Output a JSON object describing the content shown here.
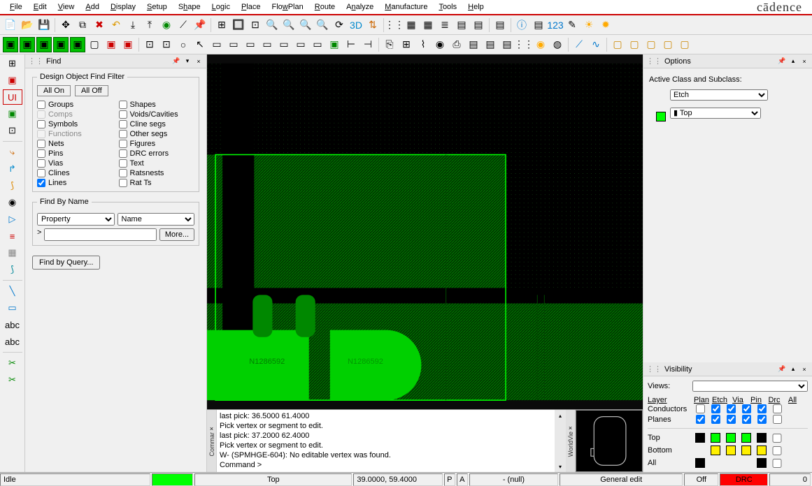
{
  "menus": [
    "File",
    "Edit",
    "View",
    "Add",
    "Display",
    "Setup",
    "Shape",
    "Logic",
    "Place",
    "FlowPlan",
    "Route",
    "Analyze",
    "Manufacture",
    "Tools",
    "Help"
  ],
  "brand": "cādence",
  "find": {
    "title": "Find",
    "legend": "Design Object Find Filter",
    "all_on": "All On",
    "all_off": "All Off",
    "items_left": [
      {
        "label": "Groups",
        "checked": false,
        "enabled": true
      },
      {
        "label": "Comps",
        "checked": false,
        "enabled": false
      },
      {
        "label": "Symbols",
        "checked": false,
        "enabled": true
      },
      {
        "label": "Functions",
        "checked": false,
        "enabled": false
      },
      {
        "label": "Nets",
        "checked": false,
        "enabled": true
      },
      {
        "label": "Pins",
        "checked": false,
        "enabled": true
      },
      {
        "label": "Vias",
        "checked": false,
        "enabled": true
      },
      {
        "label": "Clines",
        "checked": false,
        "enabled": true
      },
      {
        "label": "Lines",
        "checked": true,
        "enabled": true
      }
    ],
    "items_right": [
      {
        "label": "Shapes",
        "checked": false,
        "enabled": true
      },
      {
        "label": "Voids/Cavities",
        "checked": false,
        "enabled": true
      },
      {
        "label": "Cline segs",
        "checked": false,
        "enabled": true
      },
      {
        "label": "Other segs",
        "checked": false,
        "enabled": true
      },
      {
        "label": "Figures",
        "checked": false,
        "enabled": true
      },
      {
        "label": "DRC errors",
        "checked": false,
        "enabled": true
      },
      {
        "label": "Text",
        "checked": false,
        "enabled": true
      },
      {
        "label": "Ratsnests",
        "checked": false,
        "enabled": true
      },
      {
        "label": "Rat Ts",
        "checked": false,
        "enabled": true
      }
    ],
    "find_by_name_legend": "Find By Name",
    "property_selected": "Property",
    "name_selected": "Name",
    "more": "More...",
    "find_by_query": "Find by Query..."
  },
  "canvas": {
    "net_label_a": "N1286592",
    "net_label_b": "N1286592"
  },
  "command": {
    "lines": [
      "last pick:   36.5000 61.4000",
      "Pick vertex or segment to edit.",
      "last pick:   37.2000 62.4000",
      "Pick vertex or segment to edit.",
      "W- (SPMHGE-604): No editable vertex was found.",
      "Command >"
    ],
    "strip_label": "Commar",
    "worldview_label": "WorldVie"
  },
  "options": {
    "title": "Options",
    "label": "Active Class and Subclass:",
    "class_value": "Etch",
    "subclass_value": "Top"
  },
  "visibility": {
    "title": "Visibility",
    "views_label": "Views:",
    "layer_label": "Layer",
    "cols": [
      "Plan",
      "Etch",
      "Via",
      "Pin",
      "Drc",
      "All"
    ],
    "rows": [
      {
        "label": "Conductors",
        "checks": [
          false,
          true,
          true,
          true,
          true,
          false
        ]
      },
      {
        "label": "Planes",
        "checks": [
          true,
          true,
          true,
          true,
          true,
          false
        ]
      }
    ],
    "colorrows": [
      {
        "label": "Top",
        "colors": [
          "#000",
          "#00ff00",
          "#00ff00",
          "#00ff00",
          "#000"
        ],
        "all": false
      },
      {
        "label": "Bottom",
        "colors": [
          "",
          "#fff000",
          "#fff000",
          "#fff000",
          "#fff000"
        ],
        "all": false
      },
      {
        "label": "All",
        "colors": [
          "#000",
          "",
          "",
          "",
          "#000"
        ],
        "all": false
      }
    ]
  },
  "status": {
    "idle": "Idle",
    "layer": "Top",
    "coords": "39.0000, 59.4000",
    "p": "P",
    "a": "A",
    "null": "- (null)",
    "mode": "General edit",
    "off": "Off",
    "drc": "DRC",
    "count": "0"
  }
}
